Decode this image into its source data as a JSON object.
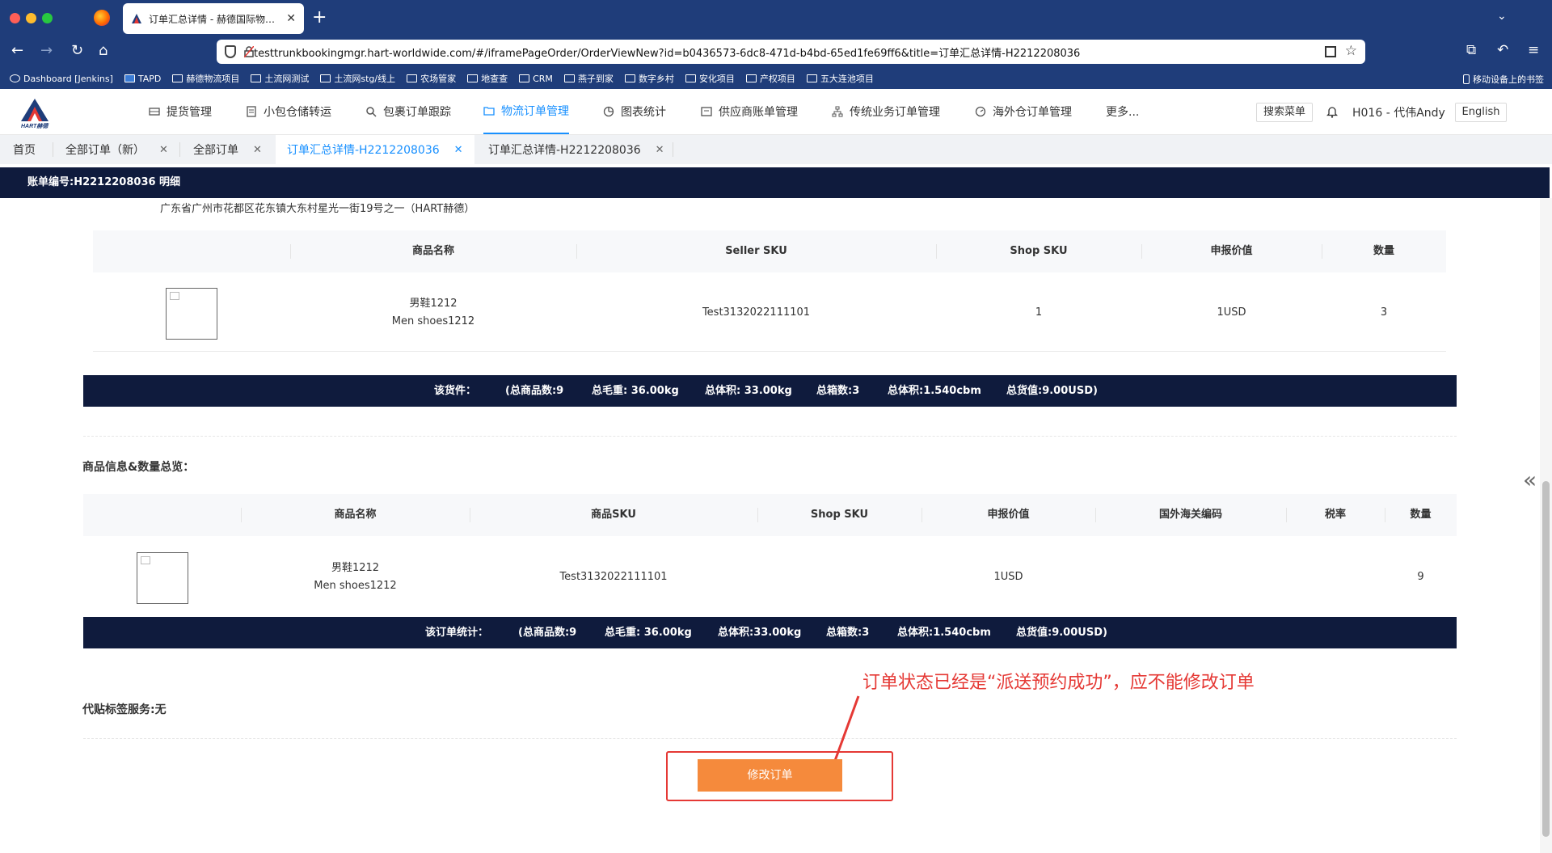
{
  "browser": {
    "tab_title": "订单汇总详情 - 赫德国际物流管理",
    "url": "testtrunkbookingmgr.hart-worldwide.com/#/iframePageOrder/OrderViewNew?id=b0436573-6dc8-471d-b4bd-65ed1fe69ff6&title=订单汇总详情-H2212208036",
    "bookmarks": [
      "Dashboard [Jenkins]",
      "TAPD",
      "赫德物流项目",
      "土流网测试",
      "土流网stg/线上",
      "农场管家",
      "地查查",
      "CRM",
      "燕子到家",
      "数字乡村",
      "安化项目",
      "产权项目",
      "五大连池项目"
    ],
    "bookmarks_right": "移动设备上的书签"
  },
  "header": {
    "menu": [
      "提货管理",
      "小包仓储转运",
      "包裹订单跟踪",
      "物流订单管理",
      "图表统计",
      "供应商账单管理",
      "传统业务订单管理",
      "海外仓订单管理",
      "更多..."
    ],
    "search_menu": "搜索菜单",
    "user": "H016 - 代伟Andy",
    "language": "English"
  },
  "page_tabs": [
    "首页",
    "全部订单（新）",
    "全部订单",
    "订单汇总详情-H2212208036",
    "订单汇总详情-H2212208036"
  ],
  "title_bar": "账单编号:H2212208036 明细",
  "address": "广东省广州市花都区花东镇大东村星光一街19号之一（HART赫德）",
  "shipment_table": {
    "headers": [
      "商品名称",
      "Seller SKU",
      "Shop SKU",
      "申报价值",
      "数量"
    ],
    "row": {
      "name_cn": "男鞋1212",
      "name_en": "Men shoes1212",
      "seller_sku": "Test3132022111101",
      "shop_sku": "1",
      "declared": "1USD",
      "qty": "3"
    }
  },
  "shipment_summary": {
    "label": "该货件：",
    "items": [
      "(总商品数:9",
      "总毛重: 36.00kg",
      "总体积: 33.00kg",
      "总箱数:3",
      "总体积:1.540cbm",
      "总货值:9.00USD)"
    ]
  },
  "overview_title": "商品信息&数量总览：",
  "overview_table": {
    "headers": [
      "商品名称",
      "商品SKU",
      "Shop SKU",
      "申报价值",
      "国外海关编码",
      "税率",
      "数量"
    ],
    "row": {
      "name_cn": "男鞋1212",
      "name_en": "Men shoes1212",
      "sku": "Test3132022111101",
      "shop_sku": "",
      "declared": "1USD",
      "hs_code": "",
      "tax": "",
      "qty": "9"
    }
  },
  "order_summary": {
    "label": "该订单统计：",
    "items": [
      "(总商品数:9",
      "总毛重: 36.00kg",
      "总体积:33.00kg",
      "总箱数:3",
      "总体积:1.540cbm",
      "总货值:9.00USD)"
    ]
  },
  "label_service": "代贴标签服务:无",
  "annotation": "订单状态已经是“派送预约成功”，应不能修改订单",
  "modify_button": "修改订单",
  "colors": {
    "nav": "#1f3d7a",
    "dark_bar": "#0f1b3d",
    "accent": "#1890ff",
    "button": "#f58a3c",
    "annotation": "#e53935"
  }
}
